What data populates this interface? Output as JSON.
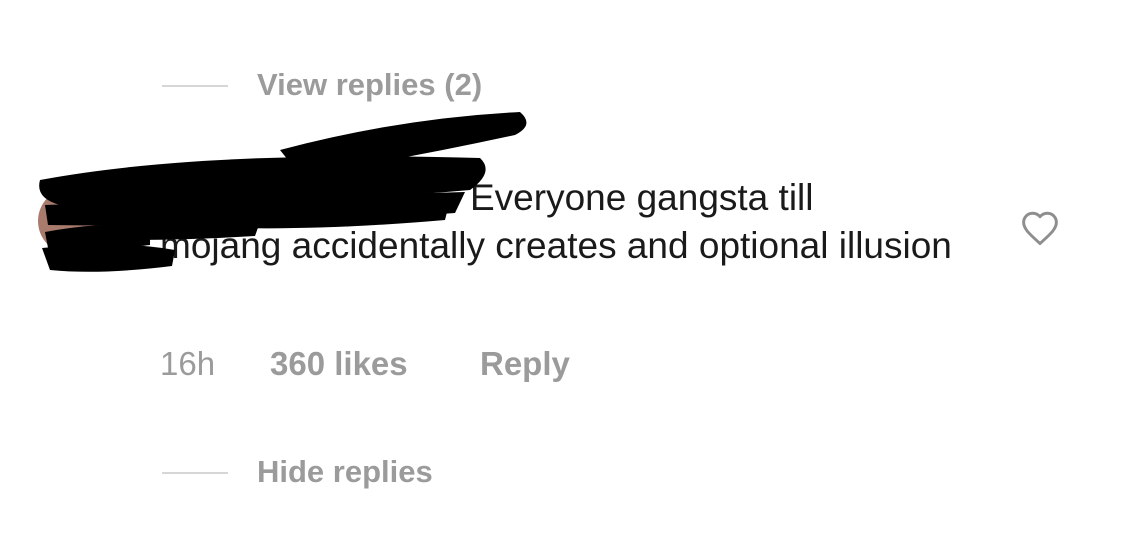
{
  "thread": {
    "view_replies_label": "View replies (2)",
    "hide_replies_label": "Hide replies"
  },
  "comment": {
    "text_line1": "Everyone gangsta till",
    "text_rest": "mojang accidentally creates and optional illusion",
    "timestamp": "16h",
    "likes": "360 likes",
    "reply_label": "Reply",
    "like_icon": "heart-outline-icon"
  },
  "colors": {
    "muted_text": "#9b9b9b",
    "body_text": "#1a1a1a",
    "thread_line": "#d6d6d6",
    "redaction": "#000000"
  }
}
